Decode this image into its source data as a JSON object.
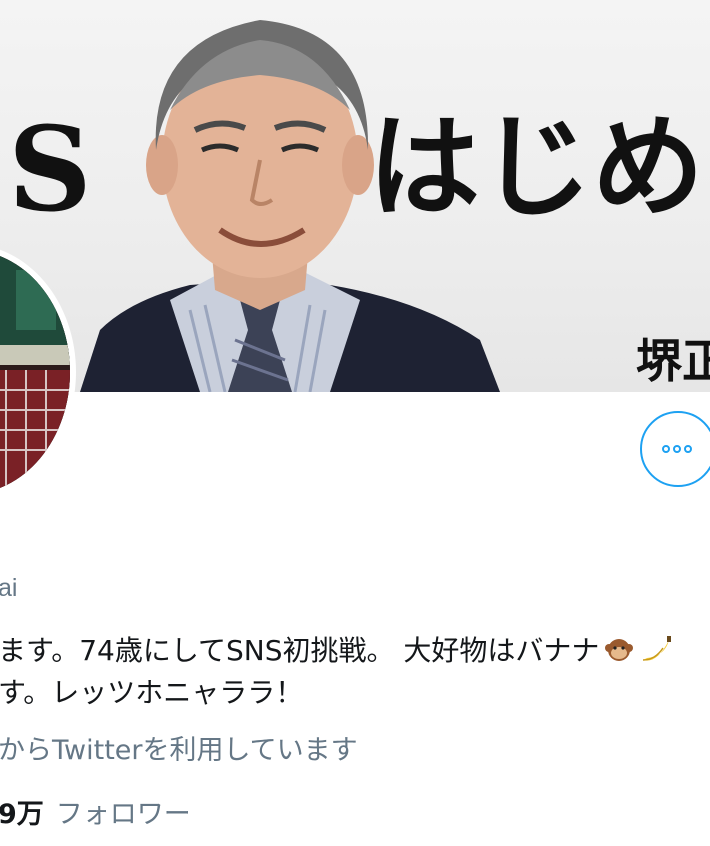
{
  "banner": {
    "text_left": "S",
    "text_right": "はじめま",
    "text_name": "堺正"
  },
  "profile": {
    "handle_partial": "ai",
    "bio_line1": "ます。74歳にしてSNS初挑戦。 大好物はバナナ",
    "bio_line2": "す。レッツホニャララ！",
    "joined": "からTwitterを利用しています",
    "followers_count": "9万",
    "followers_label": "フォロワー"
  },
  "icons": {
    "more": "more-horizontal-icon",
    "monkey": "monkey-emoji-icon",
    "banana": "banana-emoji-icon"
  },
  "colors": {
    "accent": "#1da1f2",
    "secondary_text": "#657786",
    "primary_text": "#14171a"
  }
}
